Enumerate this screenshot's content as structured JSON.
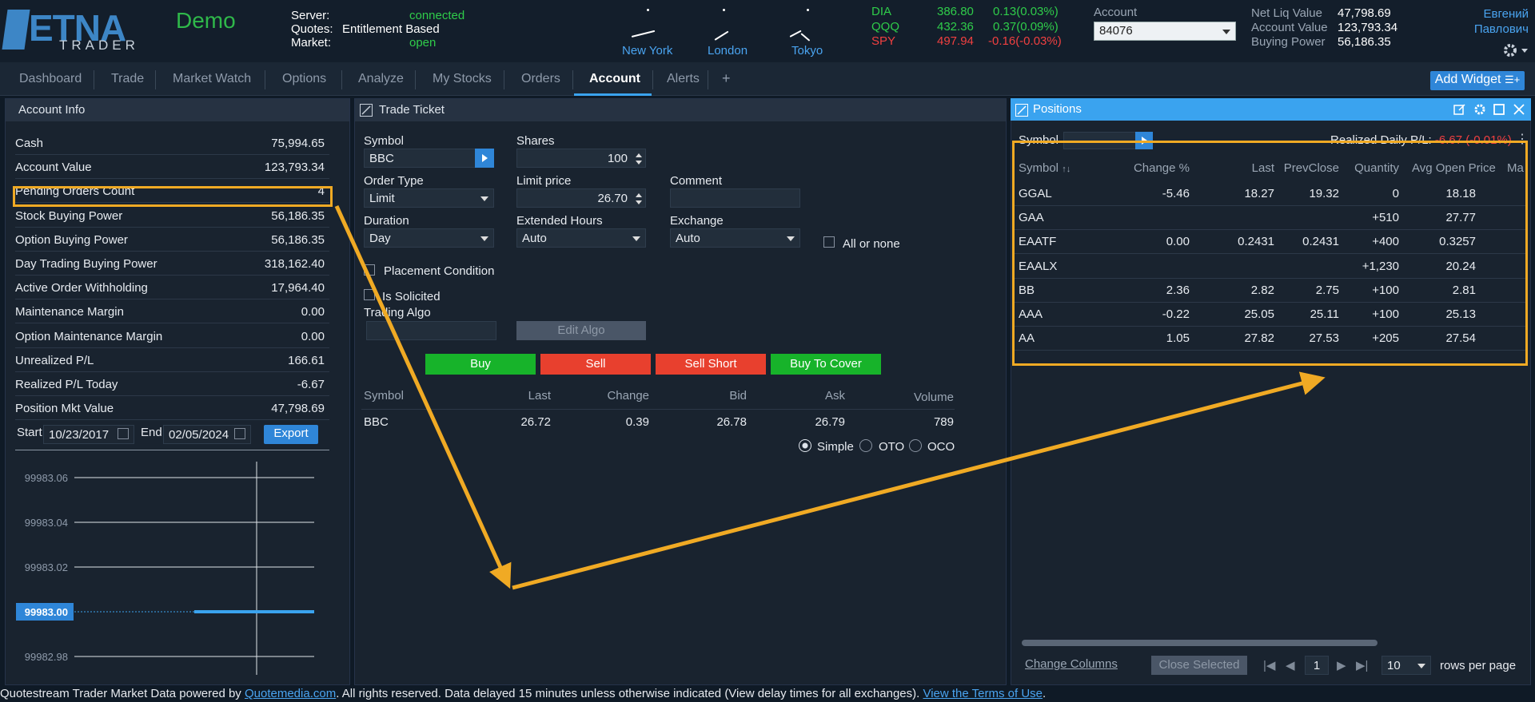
{
  "brand": {
    "name": "ETNA",
    "sub": "TRADER",
    "env": "Demo"
  },
  "status": {
    "server_label": "Server:",
    "server_value": "connected",
    "quotes_label": "Quotes:",
    "quotes_value": "Entitlement Based",
    "market_label": "Market:",
    "market_value": "open"
  },
  "clocks": [
    "New York",
    "London",
    "Tokyo"
  ],
  "tickers": [
    {
      "sym": "DIA",
      "price": "386.80",
      "chg": "0.13(0.03%)",
      "color": "green"
    },
    {
      "sym": "QQQ",
      "price": "432.36",
      "chg": "0.37(0.09%)",
      "color": "green"
    },
    {
      "sym": "SPY",
      "price": "497.94",
      "chg": "-0.16(-0.03%)",
      "color": "red"
    }
  ],
  "account": {
    "label": "Account",
    "value": "84076"
  },
  "summary": [
    {
      "label": "Net Liq Value",
      "value": "47,798.69"
    },
    {
      "label": "Account Value",
      "value": "123,793.34"
    },
    {
      "label": "Buying Power",
      "value": "56,186.35"
    }
  ],
  "user": {
    "first": "Евгений",
    "last": "Павлович"
  },
  "nav": {
    "tabs": [
      "Dashboard",
      "Trade",
      "Market Watch",
      "Options",
      "Analyze",
      "My Stocks",
      "Orders",
      "Account",
      "Alerts",
      "+"
    ],
    "active": "Account",
    "add_widget": "Add Widget"
  },
  "account_info": {
    "title": "Account Info",
    "rows": [
      {
        "label": "Cash",
        "value": "75,994.65"
      },
      {
        "label": "Account Value",
        "value": "123,793.34"
      },
      {
        "label": "Pending Orders Count",
        "value": "4"
      },
      {
        "label": "Stock Buying Power",
        "value": "56,186.35"
      },
      {
        "label": "Option Buying Power",
        "value": "56,186.35"
      },
      {
        "label": "Day Trading Buying Power",
        "value": "318,162.40"
      },
      {
        "label": "Active Order Withholding",
        "value": "17,964.40"
      },
      {
        "label": "Maintenance Margin",
        "value": "0.00"
      },
      {
        "label": "Option Maintenance Margin",
        "value": "0.00"
      },
      {
        "label": "Unrealized P/L",
        "value": "166.61"
      },
      {
        "label": "Realized P/L Today",
        "value": "-6.67"
      },
      {
        "label": "Position Mkt Value",
        "value": "47,798.69"
      }
    ],
    "start_label": "Start",
    "start_date": "10/23/2017",
    "end_label": "End",
    "end_date": "02/05/2024",
    "export": "Export"
  },
  "chart_data": {
    "type": "line",
    "y_ticks": [
      "99983.06",
      "99983.04",
      "99983.02",
      "99983.00",
      "99982.98"
    ],
    "ylim": [
      99982.97,
      99983.07
    ],
    "current_value": "99983.00",
    "series": [
      {
        "values": [
          99983.0,
          99983.0,
          99983.0
        ]
      }
    ]
  },
  "trade_ticket": {
    "title": "Trade Ticket",
    "symbol_label": "Symbol",
    "symbol_value": "BBC",
    "shares_label": "Shares",
    "shares_value": "100",
    "order_type_label": "Order Type",
    "order_type_value": "Limit",
    "limit_label": "Limit price",
    "limit_value": "26.70",
    "comment_label": "Comment",
    "duration_label": "Duration",
    "duration_value": "Day",
    "ext_label": "Extended Hours",
    "ext_value": "Auto",
    "exchange_label": "Exchange",
    "exchange_value": "Auto",
    "all_or_none": "All or none",
    "placement": "Placement Condition",
    "solicited": "Is Solicited",
    "algo_label": "Trading Algo",
    "edit_algo": "Edit Algo",
    "buttons": {
      "buy": "Buy",
      "sell": "Sell",
      "sell_short": "Sell Short",
      "buy_to_cover": "Buy To Cover"
    },
    "quote_headers": [
      "Symbol",
      "Last",
      "Change",
      "Bid",
      "Ask",
      "Volume"
    ],
    "quote_row": [
      "BBC",
      "26.72",
      "0.39",
      "26.78",
      "26.79",
      "789"
    ],
    "order_modes": [
      "Simple",
      "OTO",
      "OCO"
    ]
  },
  "positions": {
    "title": "Positions",
    "symbol_label": "Symbol",
    "realized_label": "Realized Daily P/L:",
    "realized_value": "-6.67 (-0.01%)",
    "headers": [
      "Symbol",
      "Change %",
      "Last",
      "PrevClose",
      "Quantity",
      "Avg Open Price",
      "Ma"
    ],
    "rows": [
      [
        "GGAL",
        "-5.46",
        "18.27",
        "19.32",
        "0",
        "18.18"
      ],
      [
        "GAA",
        "",
        "",
        "",
        "+510",
        "27.77"
      ],
      [
        "EAATF",
        "0.00",
        "0.2431",
        "0.2431",
        "+400",
        "0.3257"
      ],
      [
        "EAALX",
        "",
        "",
        "",
        "+1,230",
        "20.24"
      ],
      [
        "BB",
        "2.36",
        "2.82",
        "2.75",
        "+100",
        "2.81"
      ],
      [
        "AAA",
        "-0.22",
        "25.05",
        "25.11",
        "+100",
        "25.13"
      ],
      [
        "AA",
        "1.05",
        "27.82",
        "27.53",
        "+205",
        "27.54"
      ]
    ],
    "change_columns": "Change Columns",
    "close_selected": "Close Selected",
    "page": "1",
    "per_page": "10",
    "rows_per_page": "rows per page"
  },
  "footer": {
    "pre": "Quotestream Trader Market Data powered by ",
    "link1": "Quotemedia.com",
    "mid": ". All rights reserved. Data delayed 15 minutes unless otherwise indicated (View delay times for all exchanges). ",
    "link2": "View the Terms of Use",
    "post": "."
  }
}
